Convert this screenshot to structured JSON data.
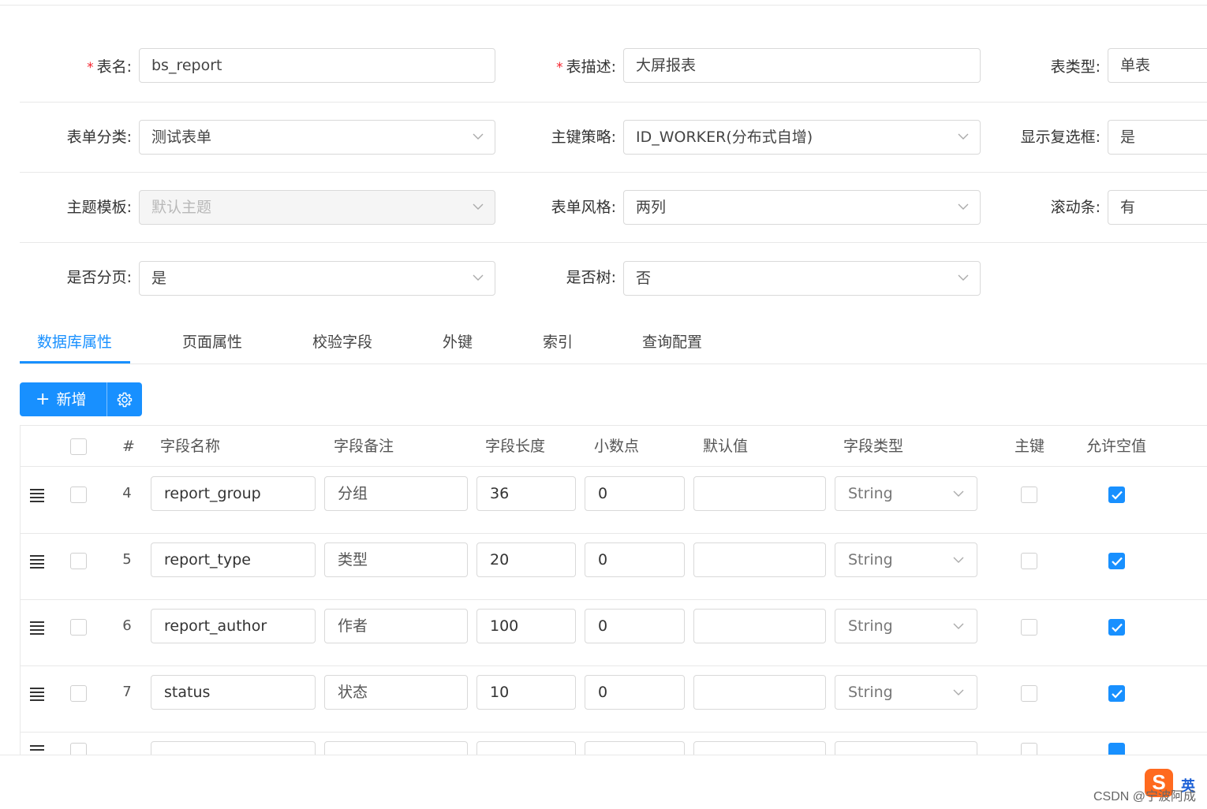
{
  "form": {
    "table_name": {
      "label": "表名:",
      "value": "bs_report"
    },
    "table_desc": {
      "label": "表描述:",
      "value": "大屏报表"
    },
    "table_type": {
      "label": "表类型:",
      "value": "单表"
    },
    "form_category": {
      "label": "表单分类:",
      "value": "测试表单"
    },
    "pk_strategy": {
      "label": "主键策略:",
      "value": "ID_WORKER(分布式自增)"
    },
    "show_checkbox": {
      "label": "显示复选框:",
      "value": "是"
    },
    "theme_template": {
      "label": "主题模板:",
      "value": "默认主题"
    },
    "form_style": {
      "label": "表单风格:",
      "value": "两列"
    },
    "scrollbar": {
      "label": "滚动条:",
      "value": "有"
    },
    "paging": {
      "label": "是否分页:",
      "value": "是"
    },
    "is_tree": {
      "label": "是否树:",
      "value": "否"
    },
    "required_mark": "*"
  },
  "tabs": [
    "数据库属性",
    "页面属性",
    "校验字段",
    "外键",
    "索引",
    "查询配置"
  ],
  "toolbar": {
    "add_label": "新增",
    "add_icon": "+"
  },
  "table": {
    "headers": [
      "#",
      "字段名称",
      "字段备注",
      "字段长度",
      "小数点",
      "默认值",
      "字段类型",
      "主键",
      "允许空值"
    ],
    "rows": [
      {
        "num": "4",
        "name": "report_group",
        "remark": "分组",
        "length": "36",
        "decimal": "0",
        "default": "",
        "type": "String",
        "pk": false,
        "nullable": true
      },
      {
        "num": "5",
        "name": "report_type",
        "remark": "类型",
        "length": "20",
        "decimal": "0",
        "default": "",
        "type": "String",
        "pk": false,
        "nullable": true
      },
      {
        "num": "6",
        "name": "report_author",
        "remark": "作者",
        "length": "100",
        "decimal": "0",
        "default": "",
        "type": "String",
        "pk": false,
        "nullable": true
      },
      {
        "num": "7",
        "name": "status",
        "remark": "状态",
        "length": "10",
        "decimal": "0",
        "default": "",
        "type": "String",
        "pk": false,
        "nullable": true
      }
    ]
  },
  "watermark": "CSDN @宁波阿成",
  "ime": {
    "logo": "S",
    "mode": "英"
  },
  "colors": {
    "primary": "#1890ff",
    "required": "#f5222d",
    "ime": "#ff6a1f"
  }
}
